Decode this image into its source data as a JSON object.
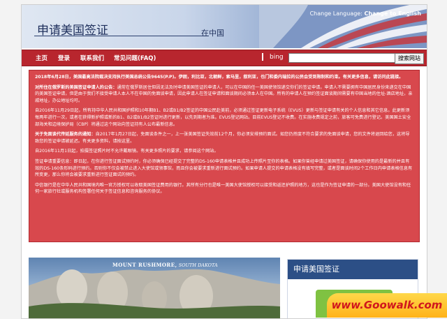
{
  "header": {
    "title": "申请美国签证",
    "subtitle": "在中国",
    "language_label": "Change Language:",
    "language_link": "Change to English"
  },
  "nav": {
    "items": [
      {
        "label": "主页"
      },
      {
        "label": "登录"
      },
      {
        "label": "联系我们"
      },
      {
        "label": "常见问题(FAQ)"
      }
    ],
    "bing_label": "bing",
    "search_value": "",
    "search_button": "搜索网站"
  },
  "notice": {
    "p1": "2018年6月28日，美国最高法院裁决支持执行美国总统公告9645(P.P)。伊朗，利比亚，北朝鲜，索马里，叙利亚，也门和委内瑞拉的公民会受到限制和约束。有关更多信息，请访问此链接。",
    "p2_bold": "对所住在俄罗斯的美国签证申请人的公告：",
    "p2": "通常在俄罗斯居住但因无法及时申请美国签证的申请人，可以在中国的任一美国使领馆递交你们的签证申请。申请人不需要拥有中国居民身份来递交在中国的美国签证申请，但是由于我们不接受申请人本人不在中国的免面谈申请，因此申请人在签证申请和面谈期间必须本人在中国。所有的申请人在预约签证面谈期间需要有中国当地的住址-酒店地址，亲戚地址，办公地址均可。",
    "p3": "自2016年11月29日起，所有持中华人民共和国护照和10年期B1、B2或B1/B2签证的中国公民赴美前，必须通过签证更新电子系统（EVUS）更新与签证申请有关的个人信息和其它信息。此更新须每两年进行一次，或者在获得新护照或新的B1、B2或B1/B2签证时进行更新，以先到期者为准。EVUS登记网站。目前EVUS登记不收费。在实施收费规定之前，旅客可免费进行登记。美国国土安全部海关和边境保护局（CBP）将通过这个网站向签证持有人公布最新信息。",
    "p4_bold": "关于免面谈代传延服务的通知：",
    "p4": "自2017年1月27日起，免面谈条件之一，上一张美国签证失效前12个月，你必须安排预约面试。如您仍然度不符合要求的免面谈申请，您的文件将退回给您，这将导致您的签证申请被延迟。有关更多资料，请按这里。",
    "p5": "自2016年11月1日起，拍摄签证照片时不允许戴眼镜。有关更多照片的要求，请参阅这个网站。",
    "p6": "签证申请重要信息：即日起，在你进行签证面试预约时，你必须确保已经提交了完整的DS-160申请表格并且成功上传照片至你的表格。如果你曾经申请过美国签证，请确保你使用的是最新的并且有效的DS-160条形码进行预约。否则你不仅会被禁止进入大使馆或领事馆，而且你会被要求重新进行面试预约。如果申请人提交的申请表格没有填写完整，或者是面谈时间2个工作日内申请表格信息有所变更，那么你将会被要求重新进行签证面试的预约。",
    "p7": "中信银行是在中华人民共和国境内唯一官方授权可以收取美国签证费用的银行。其所有分行也是唯一美国大使馆授权可以接受和返还护照的地方，这也是作为签证申请的一部分。美国大使馆没有和任何一家旅行社或服务机构签署任何关于签证信息和咨询服务的协议。"
  },
  "photo": {
    "caption_main": "MOUNT RUSHMORE,",
    "caption_sub": "SOUTH DAKOTA"
  },
  "side_box": {
    "title": "申请美国签证"
  },
  "watermark": {
    "text": "www.Goowalk.com"
  }
}
